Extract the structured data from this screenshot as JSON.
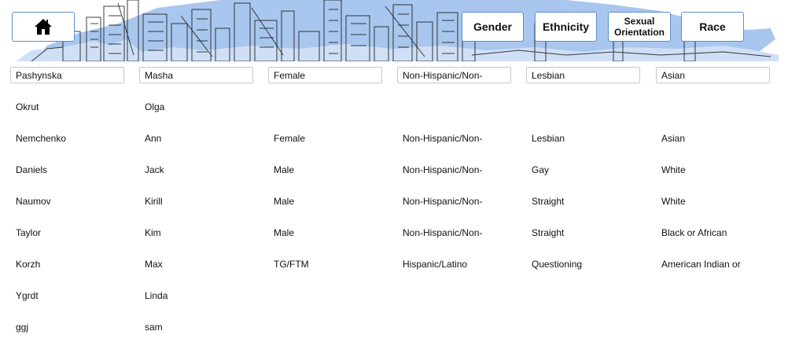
{
  "header": {
    "home_icon": "home-icon",
    "buttons": {
      "gender": "Gender",
      "ethnicity": "Ethnicity",
      "sexual_line1": "Sexual",
      "sexual_line2": "Orientation",
      "race": "Race"
    }
  },
  "filters": {
    "last_name": "Pashynska",
    "first_name": "Masha",
    "gender": "Female",
    "ethnicity": "Non-Hispanic/Non-",
    "orientation": "Lesbian",
    "race": "Asian"
  },
  "rows": [
    {
      "last": "Okrut",
      "first": "Olga",
      "gender": "",
      "ethnicity": "",
      "orientation": "",
      "race": ""
    },
    {
      "last": "Nemchenko",
      "first": "Ann",
      "gender": "Female",
      "ethnicity": "Non-Hispanic/Non-",
      "orientation": "Lesbian",
      "race": "Asian"
    },
    {
      "last": "Daniels",
      "first": "Jack",
      "gender": "Male",
      "ethnicity": "Non-Hispanic/Non-",
      "orientation": "Gay",
      "race": "White"
    },
    {
      "last": "Naumov",
      "first": "Kirill",
      "gender": "Male",
      "ethnicity": "Non-Hispanic/Non-",
      "orientation": "Straight",
      "race": "White"
    },
    {
      "last": "Taylor",
      "first": "Kim",
      "gender": "Male",
      "ethnicity": "Non-Hispanic/Non-",
      "orientation": "Straight",
      "race": "Black or African"
    },
    {
      "last": "Korzh",
      "first": "Max",
      "gender": "TG/FTM",
      "ethnicity": "Hispanic/Latino",
      "orientation": "Questioning",
      "race": "American Indian or"
    },
    {
      "last": "Ygrdt",
      "first": "Linda",
      "gender": "",
      "ethnicity": "",
      "orientation": "",
      "race": ""
    },
    {
      "last": "ggj",
      "first": "sam",
      "gender": "",
      "ethnicity": "",
      "orientation": "",
      "race": ""
    }
  ]
}
